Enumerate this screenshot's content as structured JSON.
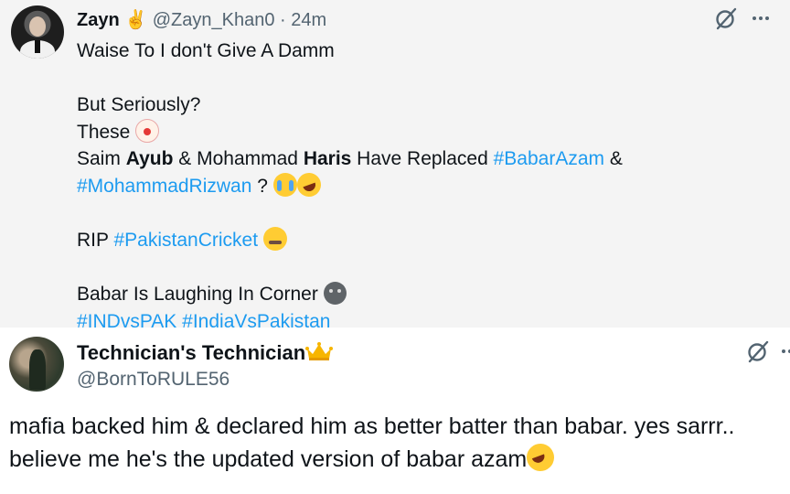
{
  "tweet1": {
    "display_name": "Zayn",
    "name_emoji": "✌",
    "handle": "@Zayn_Khan0",
    "separator": "·",
    "time": "24m",
    "lines": {
      "l1": "Waise To I don't Give A Damm",
      "l2": "But Seriously?",
      "l3": "These",
      "l4_a": "Saim ",
      "l4_b": "Ayub",
      "l4_c": " & Mohammad ",
      "l4_d": "Haris",
      "l4_e": " Have Replaced ",
      "l4_f": "#BabarAzam",
      "l4_g": " &",
      "l5_a": "#MohammadRizwan",
      "l5_b": " ? ",
      "l6_a": "RIP ",
      "l6_b": "#PakistanCricket",
      "l7": "Babar Is Laughing In Corner ",
      "l8_a": "#INDvsPAK",
      "l8_b": " ",
      "l8_c": "#IndiaVsPakistan"
    },
    "icons": [
      "avatar",
      "grok-icon",
      "more-icon",
      "clown-emoji",
      "crying-emoji",
      "rofl-emoji",
      "sick-emoji",
      "dark-face-emoji"
    ]
  },
  "tweet2": {
    "display_name": "Technician's Technician",
    "handle": "@BornToRULE56",
    "line1": "mafia backed him & declared him as better batter than babar. yes sarrr..",
    "line2": "believe me he's the updated version of babar azam",
    "icons": [
      "avatar",
      "crown-emoji",
      "grok-icon",
      "more-icon",
      "rofl-emoji"
    ]
  },
  "colors": {
    "link": "#1d9bf0",
    "text": "#0f1419",
    "muted": "#536471",
    "tweet1_bg": "#f4f4f4"
  }
}
